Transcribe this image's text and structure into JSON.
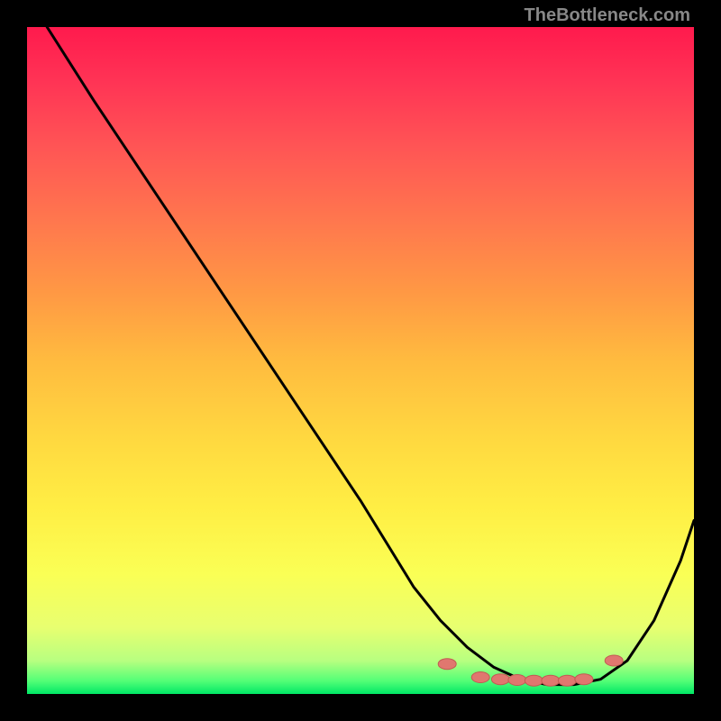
{
  "watermark": "TheBottleneck.com",
  "chart_data": {
    "type": "line",
    "title": "",
    "xlabel": "",
    "ylabel": "",
    "xlim": [
      0,
      100
    ],
    "ylim": [
      0,
      100
    ],
    "series": [
      {
        "name": "curve",
        "color": "#000000",
        "x": [
          3,
          10,
          20,
          30,
          40,
          50,
          58,
          62,
          66,
          70,
          74,
          78,
          82,
          86,
          90,
          94,
          98,
          100
        ],
        "y": [
          100,
          89,
          74,
          59,
          44,
          29,
          16,
          11,
          7,
          4,
          2.2,
          1.4,
          1.4,
          2.2,
          5,
          11,
          20,
          26
        ]
      }
    ],
    "markers": {
      "color": "#e0776f",
      "shape": "horizontal-oval",
      "points": [
        {
          "x": 63,
          "y": 4.5
        },
        {
          "x": 68,
          "y": 2.5
        },
        {
          "x": 71,
          "y": 2.2
        },
        {
          "x": 73.5,
          "y": 2.1
        },
        {
          "x": 76,
          "y": 2.0
        },
        {
          "x": 78.5,
          "y": 2.0
        },
        {
          "x": 81,
          "y": 2.0
        },
        {
          "x": 83.5,
          "y": 2.2
        },
        {
          "x": 88,
          "y": 5.0
        }
      ]
    }
  }
}
